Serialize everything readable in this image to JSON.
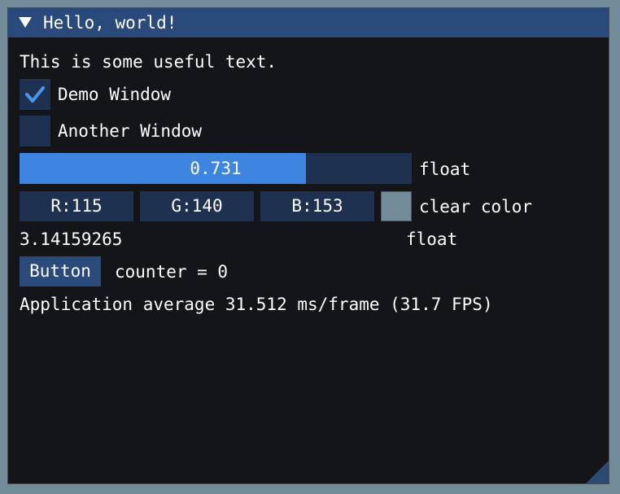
{
  "window": {
    "title": "Hello, world!"
  },
  "content": {
    "useful_text": "This is some useful text.",
    "demo_window": {
      "label": "Demo Window",
      "checked": true
    },
    "another_window": {
      "label": "Another Window",
      "checked": false
    },
    "float_slider": {
      "value": "0.731",
      "fraction": 0.731,
      "label": "float"
    },
    "clear_color": {
      "r": "R:115",
      "g": "G:140",
      "b": "B:153",
      "swatch_color": "#738c99",
      "label": "clear color"
    },
    "pi_value": {
      "value": "3.14159265",
      "label": "float"
    },
    "button": {
      "label": "Button"
    },
    "counter_text": "counter = 0",
    "fps_text": "Application average 31.512 ms/frame (31.7 FPS)"
  },
  "colors": {
    "title_bar": "#294a7a",
    "window_bg": "#131519",
    "frame_bg": "#1f3150",
    "accent": "#3d85e0",
    "desktop_bg": "#738c99"
  }
}
